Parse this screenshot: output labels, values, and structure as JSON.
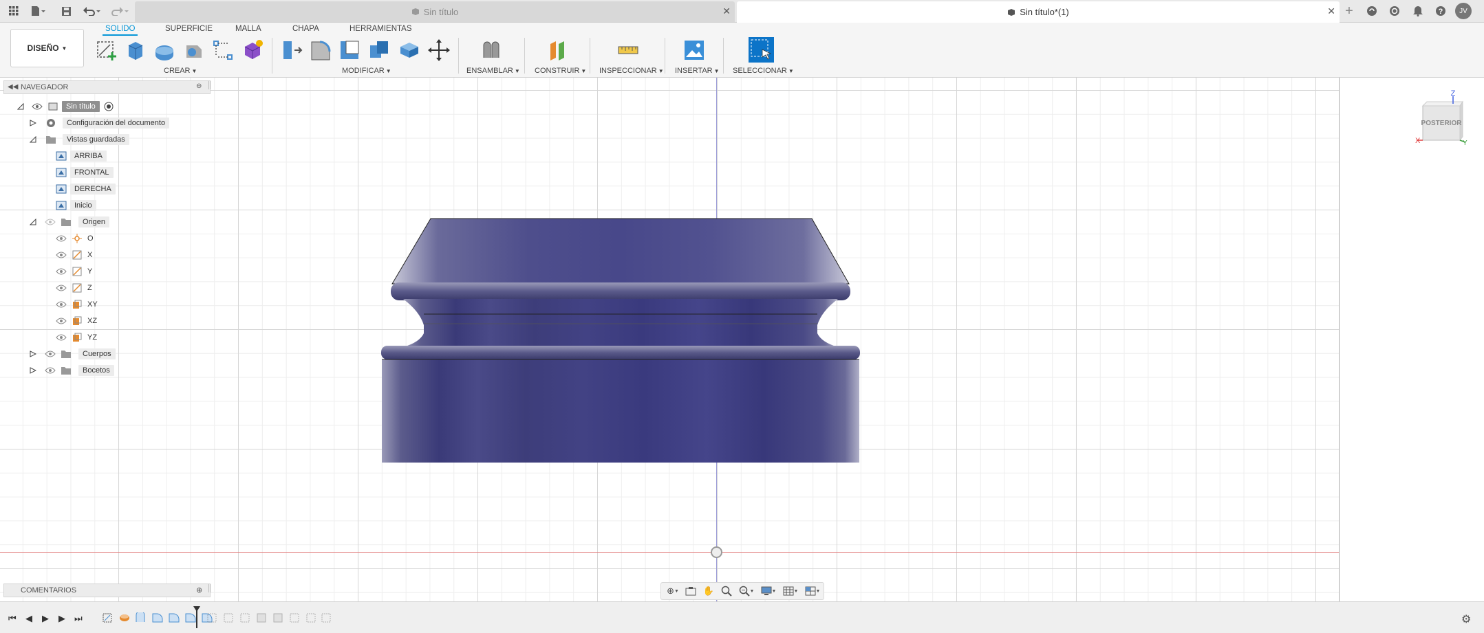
{
  "window": {
    "tabs": [
      {
        "title": "Sin título",
        "active": false
      },
      {
        "title": "Sin título*(1)",
        "active": true
      }
    ],
    "user_initials": "JV"
  },
  "ribbon": {
    "workspace": "DISEÑO",
    "tabs": [
      "SOLIDO",
      "SUPERFICIE",
      "MALLA",
      "CHAPA",
      "HERRAMIENTAS"
    ],
    "active_tab": "SOLIDO",
    "groups": [
      "CREAR",
      "MODIFICAR",
      "ENSAMBLAR",
      "CONSTRUIR",
      "INSPECCIONAR",
      "INSERTAR",
      "SELECCIONAR"
    ]
  },
  "navigator": {
    "title": "NAVEGADOR",
    "root": "Sin título",
    "items": [
      {
        "label": "Configuración del documento"
      },
      {
        "label": "Vistas guardadas"
      },
      {
        "label": "ARRIBA"
      },
      {
        "label": "FRONTAL"
      },
      {
        "label": "DERECHA"
      },
      {
        "label": "Inicio"
      },
      {
        "label": "Origen"
      },
      {
        "label": "O"
      },
      {
        "label": "X"
      },
      {
        "label": "Y"
      },
      {
        "label": "Z"
      },
      {
        "label": "XY"
      },
      {
        "label": "XZ"
      },
      {
        "label": "YZ"
      },
      {
        "label": "Cuerpos"
      },
      {
        "label": "Bocetos"
      }
    ]
  },
  "comments": {
    "title": "COMENTARIOS"
  },
  "viewcube": {
    "face": "POSTERIOR",
    "axis_z": "Z",
    "axis_x": "X",
    "axis_y": "Y"
  },
  "colors": {
    "accent": "#0696d7",
    "body": "#3a3a7a",
    "axis_red": "#e38080",
    "axis_blue": "#9a9ad6"
  }
}
